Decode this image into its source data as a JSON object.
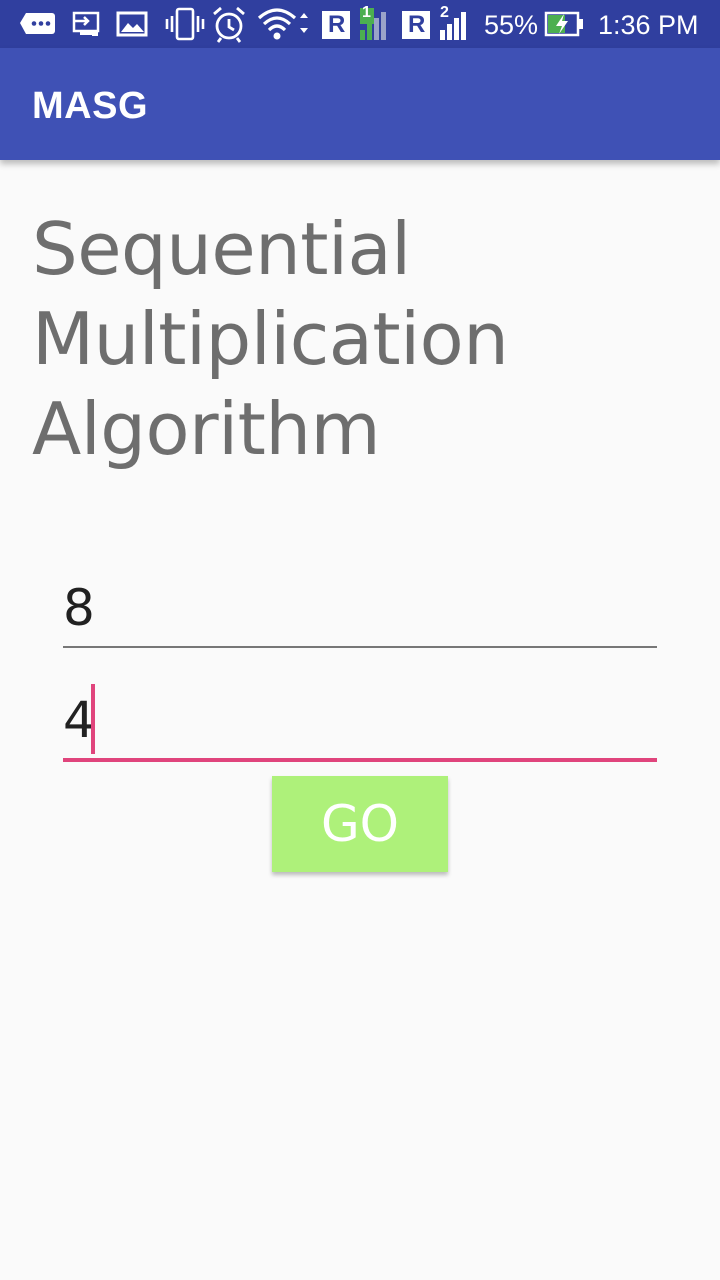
{
  "status_bar": {
    "battery_percent": "55%",
    "time": "1:36 PM",
    "sim1_label": "R",
    "sim1_index": "1",
    "sim2_label": "R",
    "sim2_index": "2",
    "icons": [
      "chat-icon",
      "screen-cast-icon",
      "gallery-icon",
      "vibrate-icon",
      "alarm-icon",
      "wifi-icon",
      "signal-sim1-icon",
      "signal-sim2-icon",
      "battery-charging-icon"
    ],
    "color": "#303f9f"
  },
  "app_bar": {
    "title": "MASG",
    "color": "#3f51b5"
  },
  "main": {
    "heading": "Sequential Multiplication Algorithm",
    "first_input": {
      "value": "8"
    },
    "second_input": {
      "value": "4",
      "focused": true
    },
    "go_button": {
      "label": "GO",
      "color": "#aef17a"
    },
    "accent_color": "#e0447c"
  }
}
